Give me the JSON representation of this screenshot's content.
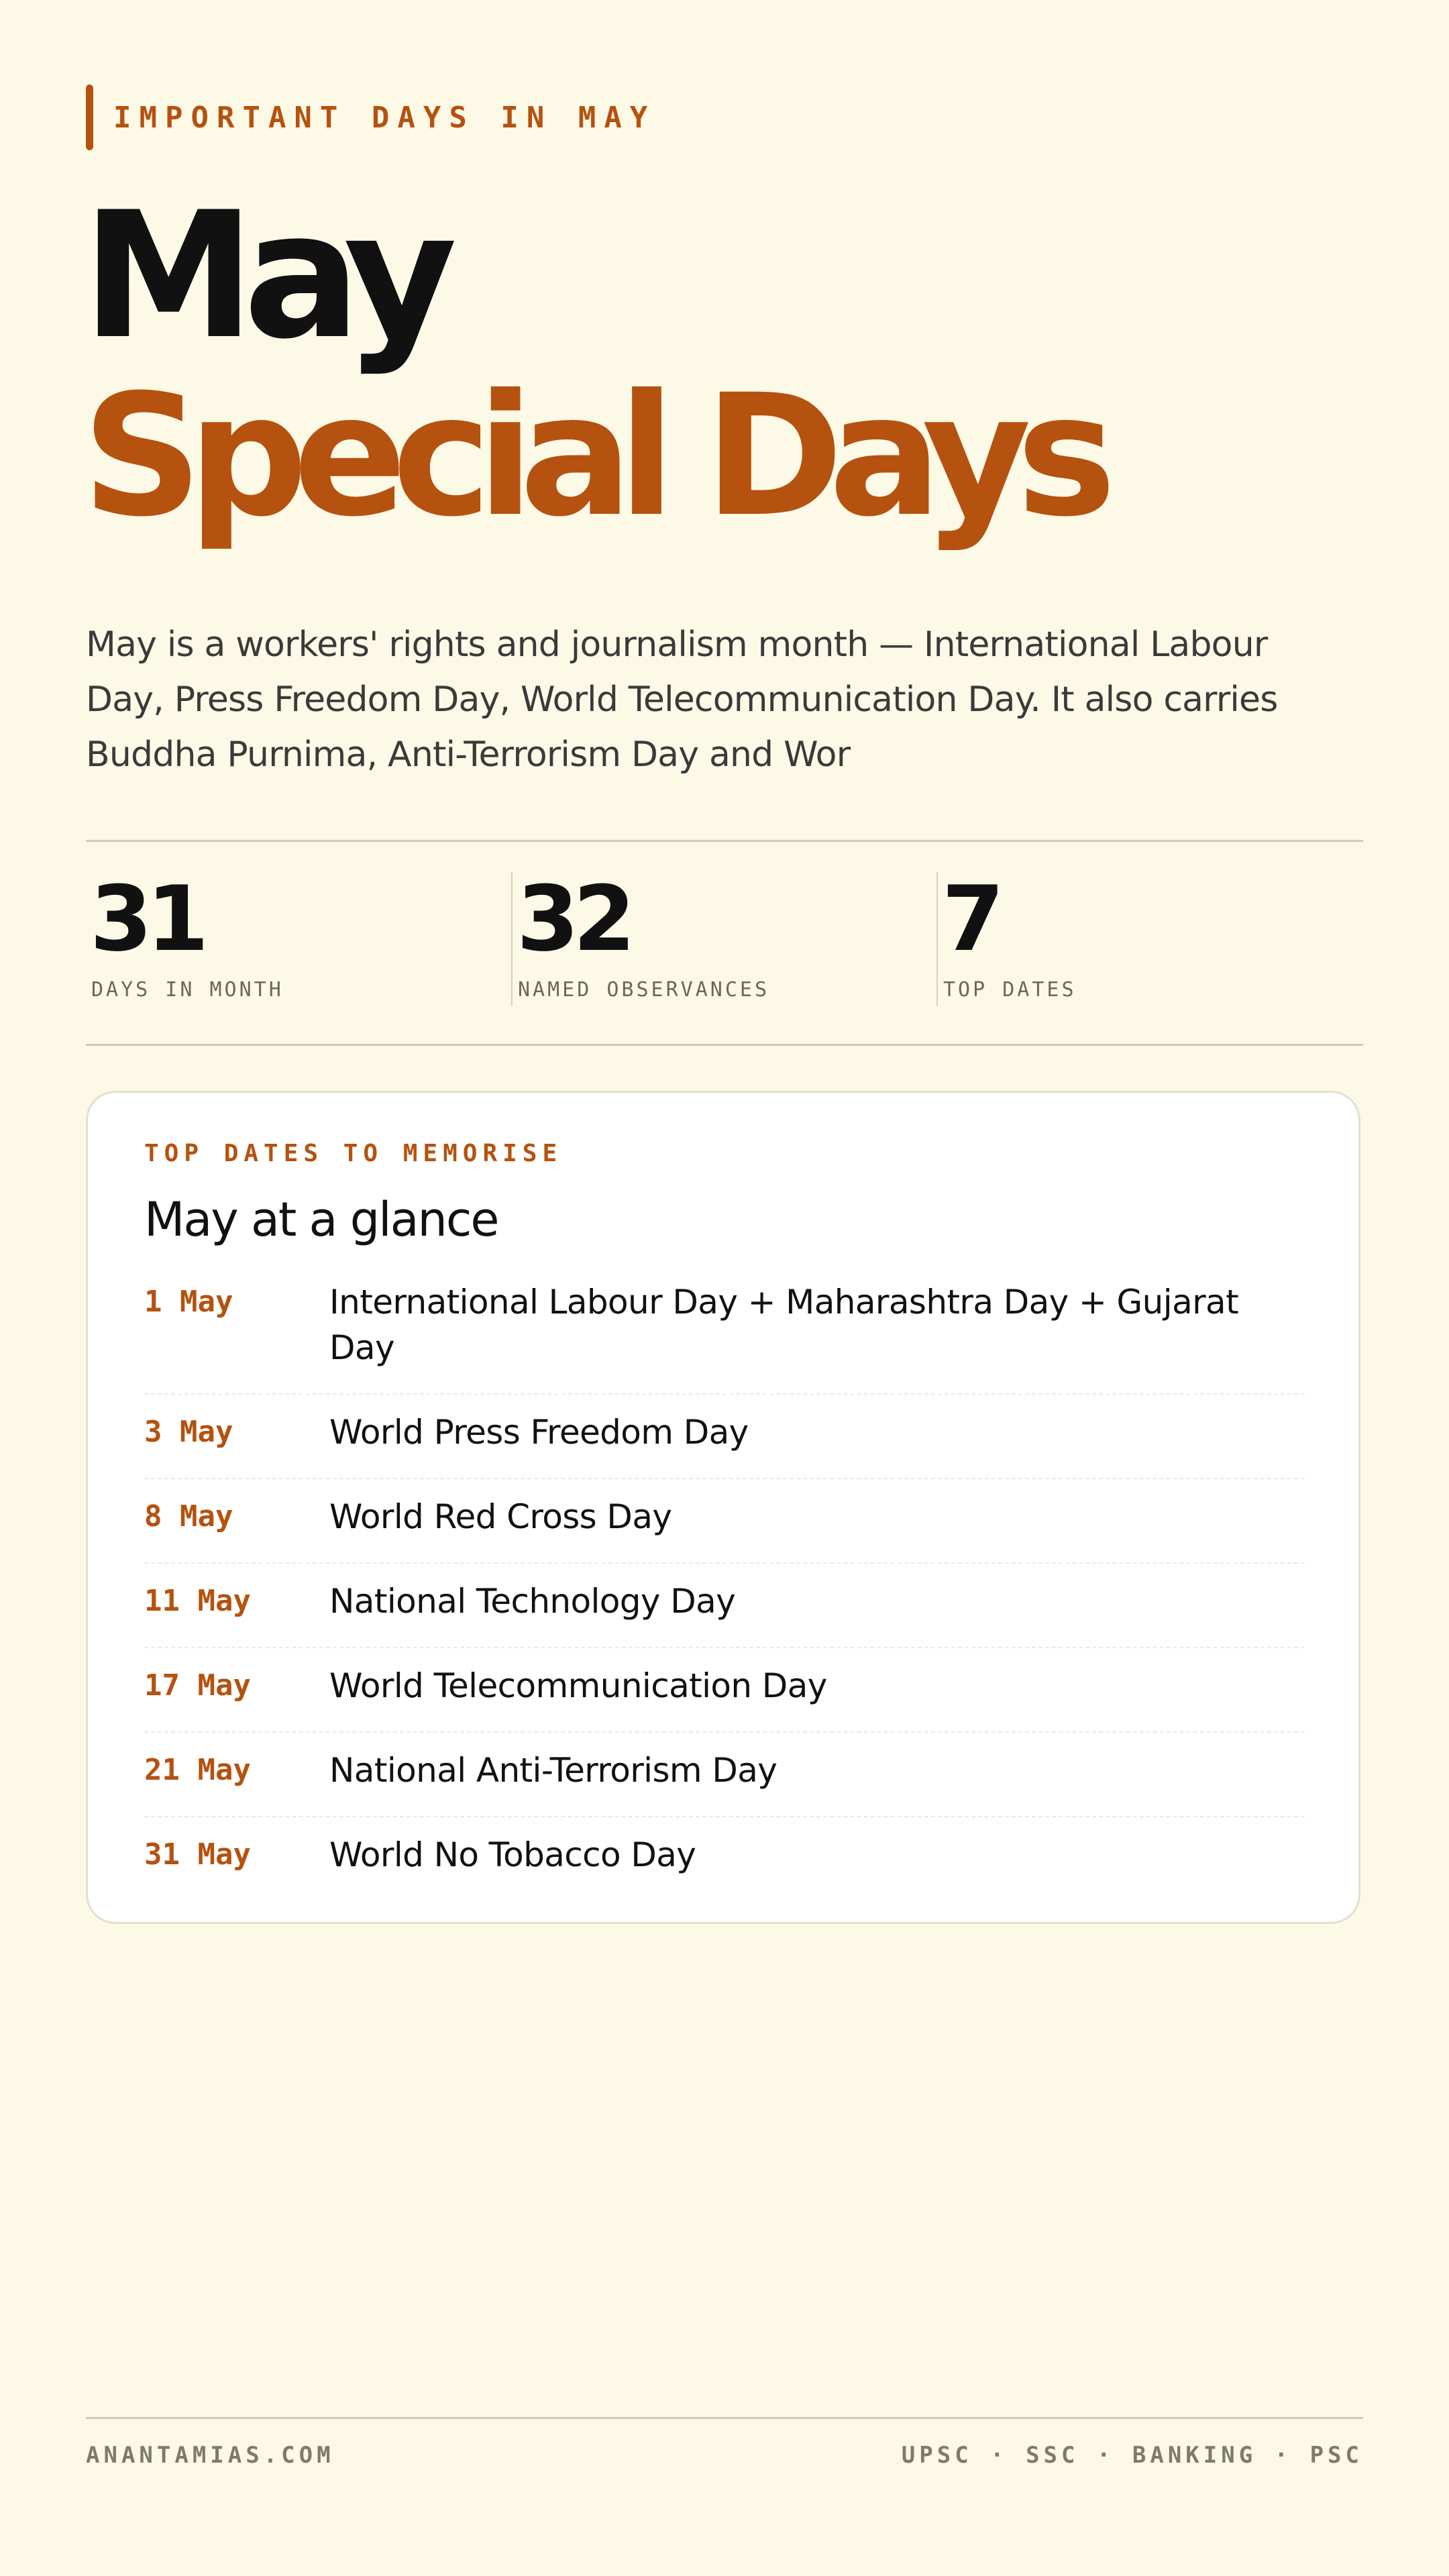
{
  "header": {
    "eyebrow": "IMPORTANT DAYS IN MAY",
    "title_line1": "May",
    "title_line2": "Special Days"
  },
  "intro": "May is a workers' rights and journalism month — International Labour Day, Press Freedom Day, World Telecommunication Day. It also carries Buddha Purnima, Anti-Terrorism Day and Wor",
  "stats": [
    {
      "value": "31",
      "label": "DAYS IN MONTH"
    },
    {
      "value": "32",
      "label": "NAMED OBSERVANCES"
    },
    {
      "value": "7",
      "label": "TOP DATES"
    }
  ],
  "card": {
    "eyebrow": "TOP DATES TO MEMORISE",
    "title": "May at a glance",
    "dates": [
      {
        "date": "1 May",
        "name": "International Labour Day + Maharashtra Day + Gujarat Day"
      },
      {
        "date": "3 May",
        "name": "World Press Freedom Day"
      },
      {
        "date": "8 May",
        "name": "World Red Cross Day"
      },
      {
        "date": "11 May",
        "name": "National Technology Day"
      },
      {
        "date": "17 May",
        "name": "World Telecommunication Day"
      },
      {
        "date": "21 May",
        "name": "National Anti-Terrorism Day"
      },
      {
        "date": "31 May",
        "name": "World No Tobacco Day"
      }
    ]
  },
  "footer": {
    "left": "ANANTAMIAS.COM",
    "right": "UPSC · SSC · BANKING · PSC"
  },
  "colors": {
    "background": "#FDF9E7",
    "accent": "#B5520F",
    "text": "#111111",
    "muted": "#6B6858",
    "card": "#FFFFFF"
  }
}
